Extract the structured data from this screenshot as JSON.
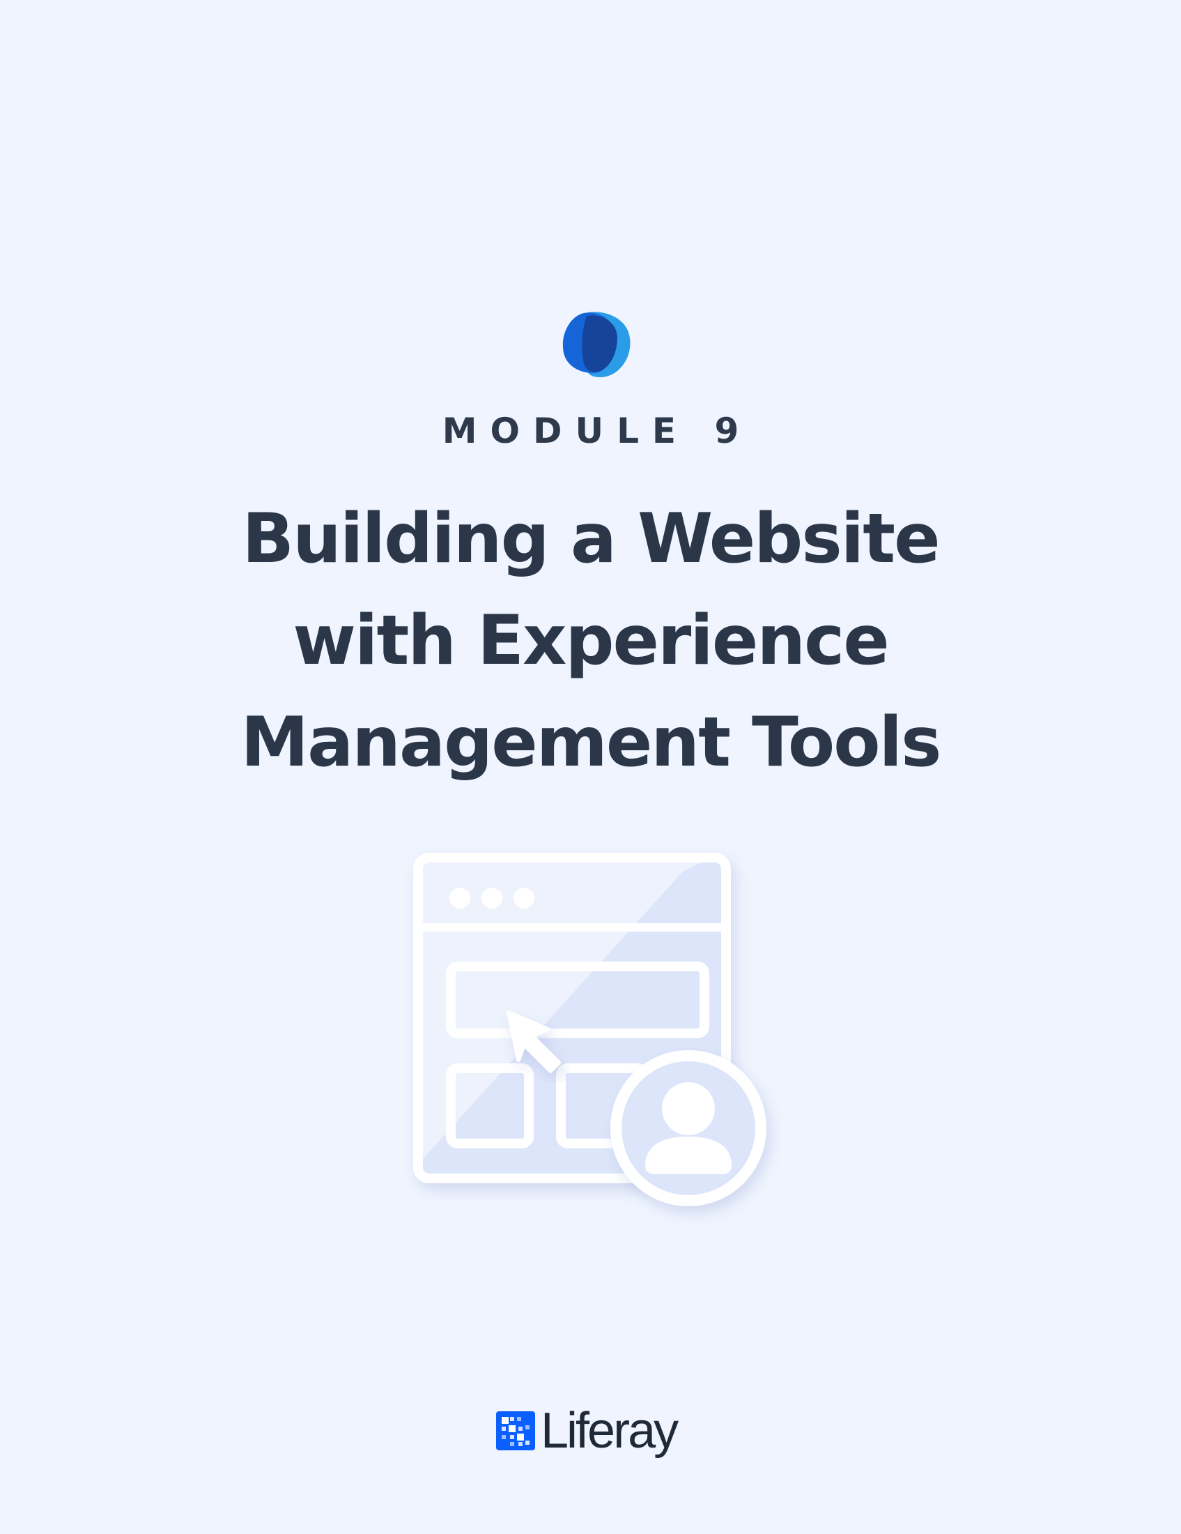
{
  "header": {
    "module_label": "MODULE 9"
  },
  "title": {
    "lines": [
      "Building a Website",
      "with Experience",
      "Management Tools"
    ]
  },
  "illustration": {
    "icons": [
      "browser-window-icon",
      "cursor-icon",
      "user-avatar-icon"
    ]
  },
  "footer": {
    "brand_name": "Liferay"
  },
  "colors": {
    "background": "#EFF4FE",
    "text": "#2B3748",
    "brand_blue": "#0B5FFF",
    "logo_dark": "#17449B",
    "logo_light": "#2A9CE8"
  }
}
